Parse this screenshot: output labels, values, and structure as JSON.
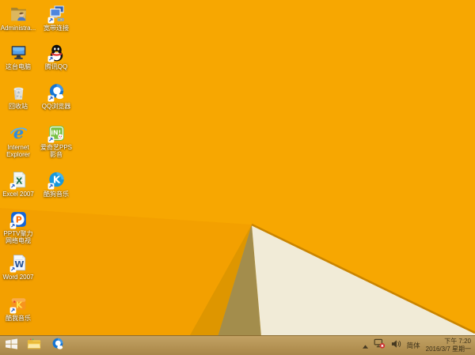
{
  "wallpaper": {
    "base_color": "#F7A701",
    "lower_left_shade_color": "#F3A000",
    "dark_orange_facet_color": "#DE9600",
    "olive_facet_color": "#A38D4C",
    "cream_facet_color": "#F1EBD7",
    "facet_edge_color": "#C98400"
  },
  "glyphs": {
    "ie": "e",
    "iqiyi": "iN!",
    "excel": "X",
    "kugou": "K",
    "pptv": "P",
    "word": "W",
    "kuwo": "K"
  },
  "desktop": {
    "icons": [
      {
        "id": "administrator-folder",
        "label": "Administra..."
      },
      {
        "id": "broadband-connection",
        "label": "宽带连接"
      },
      {
        "id": "this-pc",
        "label": "这台电脑"
      },
      {
        "id": "tencent-qq",
        "label": "腾讯QQ"
      },
      {
        "id": "recycle-bin",
        "label": "回收站"
      },
      {
        "id": "qq-browser",
        "label": "QQ浏览器"
      },
      {
        "id": "internet-explorer",
        "label": "Internet Explorer"
      },
      {
        "id": "iqiyi-pps",
        "label": "爱奇艺PPS 影音"
      },
      {
        "id": "excel-2007",
        "label": "Excel 2007"
      },
      {
        "id": "kugou-music",
        "label": "酷狗音乐"
      },
      {
        "id": "pptv",
        "label": "PPTV聚力 网络电视"
      },
      {
        "id": "word-2007",
        "label": "Word 2007"
      },
      {
        "id": "kuwo-music",
        "label": "酷我音乐"
      }
    ]
  },
  "taskbar": {
    "buttons": [
      {
        "id": "start"
      },
      {
        "id": "file-explorer"
      },
      {
        "id": "qq-browser"
      }
    ],
    "tray": {
      "input_method": "简体",
      "time": "下午 7:20",
      "date": "2016/3/7 星期一"
    }
  }
}
